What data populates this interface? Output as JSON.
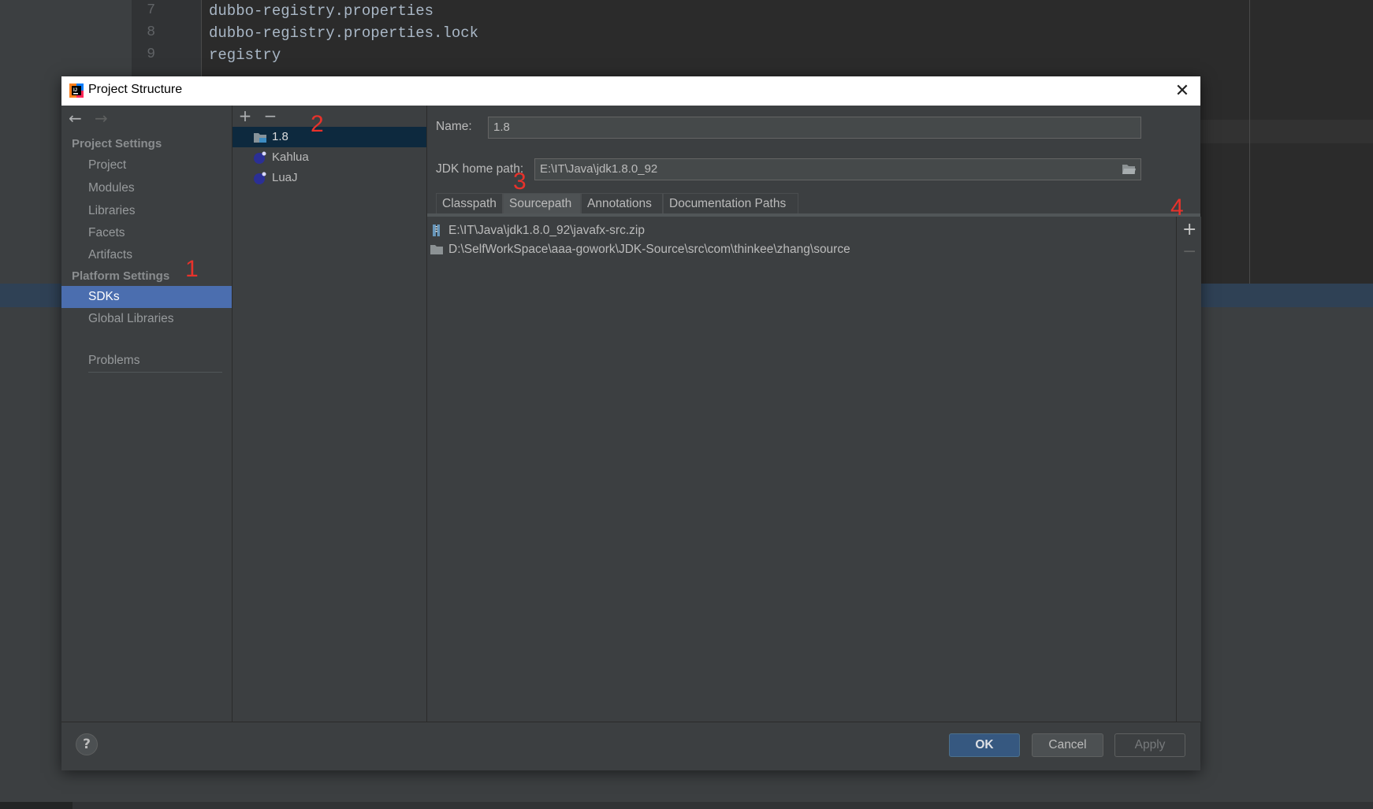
{
  "editor": {
    "lines": [
      {
        "num": "7",
        "text": "dubbo-registry.properties"
      },
      {
        "num": "8",
        "text": "dubbo-registry.properties.lock"
      },
      {
        "num": "9",
        "text": "registry"
      }
    ]
  },
  "dialog": {
    "title": "Project Structure",
    "close_glyph": "✕"
  },
  "sidebar": {
    "back_glyph": "←",
    "forward_glyph": "→",
    "project_settings_header": "Project Settings",
    "platform_settings_header": "Platform Settings",
    "items": {
      "project": "Project",
      "modules": "Modules",
      "libraries": "Libraries",
      "facets": "Facets",
      "artifacts": "Artifacts",
      "sdks": "SDKs",
      "global_libraries": "Global Libraries",
      "problems": "Problems"
    }
  },
  "sdk_list": {
    "add_glyph": "+",
    "remove_glyph": "−",
    "items": [
      "1.8",
      "Kahlua",
      "LuaJ"
    ]
  },
  "detail": {
    "name_label": "Name:",
    "name_value": "1.8",
    "jdk_home_label": "JDK home path:",
    "jdk_home_value": "E:\\IT\\Java\\jdk1.8.0_92",
    "tabs": [
      "Classpath",
      "Sourcepath",
      "Annotations",
      "Documentation Paths"
    ],
    "paths": [
      "E:\\IT\\Java\\jdk1.8.0_92\\javafx-src.zip",
      "D:\\SelfWorkSpace\\aaa-gowork\\JDK-Source\\src\\com\\thinkee\\zhang\\source"
    ],
    "add_glyph": "+",
    "remove_glyph": "−"
  },
  "footer": {
    "help": "?",
    "ok": "OK",
    "cancel": "Cancel",
    "apply": "Apply"
  },
  "annotations": [
    "1",
    "2",
    "3",
    "4"
  ],
  "colors": {
    "selection": "#4b6eaf",
    "list_selection": "#0d293e",
    "annotation": "#e8322b",
    "primary_button": "#365880"
  }
}
